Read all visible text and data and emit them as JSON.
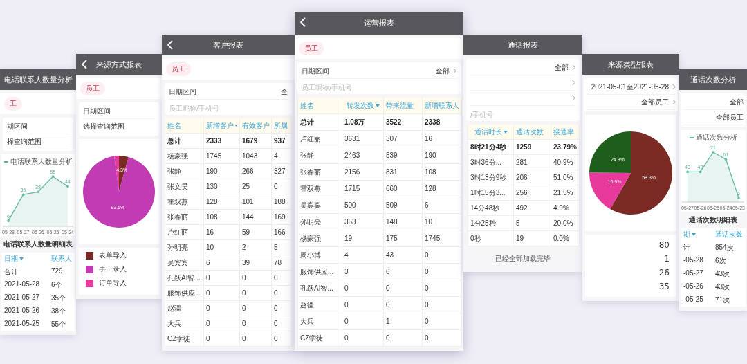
{
  "screens": [
    {
      "sections": [
        {
          "kind": "header",
          "title": "电话联系人数量分析",
          "back_button": false
        },
        {
          "kind": "tag",
          "label": "工",
          "selected": true
        },
        {
          "kind": "filters",
          "rows": [
            {
              "label": "期区间",
              "chevron": false
            },
            {
              "label": "择查询范围",
              "chevron": false
            }
          ]
        },
        {
          "kind": "chart",
          "chart_data": {
            "type": "line",
            "categories": [
              "05-28",
              "05-27",
              "05-26",
              "05-25",
              "05-24"
            ],
            "series": [
              {
                "name": "电话联系人数量分析",
                "color": "#5fb8a0",
                "values": [
                  6,
                  35,
                  38,
                  55,
                  44
                ]
              }
            ],
            "data_labels": true
          }
        },
        {
          "kind": "table_title",
          "text": "电话联系人数量明细表"
        },
        {
          "kind": "detail_table",
          "columns": [
            {
              "label": "日期",
              "sorted": true
            },
            {
              "label": "联系人",
              "sorted": false
            }
          ],
          "rows": [
            {
              "cells": [
                "合计",
                "729"
              ],
              "total": false
            },
            {
              "cells": [
                "2021-05-28",
                "6个"
              ],
              "total": false
            },
            {
              "cells": [
                "2021-05-27",
                "35个"
              ],
              "total": false
            },
            {
              "cells": [
                "2021-05-26",
                "38个"
              ],
              "total": false
            },
            {
              "cells": [
                "2021-05-25",
                "55个"
              ],
              "total": false
            }
          ]
        }
      ]
    },
    {
      "sections": [
        {
          "kind": "header",
          "title": "来源方式报表",
          "back_button": true
        },
        {
          "kind": "tag",
          "label": "员工",
          "selected": true
        },
        {
          "kind": "filters",
          "rows": [
            {
              "label": "日期区间",
              "chevron": false
            },
            {
              "label": "选择查询范围",
              "chevron": false
            }
          ]
        },
        {
          "kind": "chart",
          "chart_data": {
            "type": "pie",
            "values": [
              4.3,
              93.6,
              2.1
            ],
            "value_labels": [
              "4.3%",
              "93.6%",
              null
            ]
          },
          "slices": [
            {
              "color": "#7b2b24"
            },
            {
              "color": "#c13bb3"
            },
            {
              "color": "#e83a9c"
            }
          ]
        },
        {
          "kind": "legend",
          "items": [
            {
              "label": "表单导入",
              "color": "#7b2b24"
            },
            {
              "label": "手工录入",
              "color": "#c13bb3"
            },
            {
              "label": "订单导入",
              "color": "#e83a9c"
            }
          ]
        }
      ]
    },
    {
      "sections": [
        {
          "kind": "header",
          "title": "客户报表",
          "back_button": true
        },
        {
          "kind": "tag",
          "label": "员工",
          "selected": true
        },
        {
          "kind": "filters",
          "rows": [
            {
              "label": "日期区间",
              "value": "全",
              "chevron": false
            }
          ],
          "placeholder": "员工昵称/手机号"
        },
        {
          "kind": "table",
          "columns": [
            {
              "label": "姓名",
              "sorted": false
            },
            {
              "label": "新增客户",
              "sorted": true
            },
            {
              "label": "有效客户",
              "sorted": false
            },
            {
              "label": "所属",
              "sorted": false
            }
          ],
          "rows": [
            {
              "cells": [
                "总计",
                "2333",
                "1679",
                "937"
              ],
              "total": true
            },
            {
              "cells": [
                "杨豪强",
                "1745",
                "1043",
                "4"
              ],
              "total": false
            },
            {
              "cells": [
                "张静",
                "190",
                "266",
                "327"
              ],
              "total": false
            },
            {
              "cells": [
                "张文昊",
                "130",
                "25",
                "0"
              ],
              "total": false
            },
            {
              "cells": [
                "霍双燕",
                "128",
                "101",
                "188"
              ],
              "total": false
            },
            {
              "cells": [
                "张春丽",
                "108",
                "144",
                "169"
              ],
              "total": false
            },
            {
              "cells": [
                "卢红丽",
                "16",
                "59",
                "166"
              ],
              "total": false
            },
            {
              "cells": [
                "孙明亮",
                "10",
                "2",
                "5"
              ],
              "total": false
            },
            {
              "cells": [
                "吴宾宾",
                "6",
                "39",
                "78"
              ],
              "total": false
            },
            {
              "cells": [
                "孔跃AI智...",
                "0",
                "0",
                "0"
              ],
              "total": false
            },
            {
              "cells": [
                "服饰供应...",
                "0",
                "0",
                "0"
              ],
              "total": false
            },
            {
              "cells": [
                "赵疆",
                "0",
                "0",
                "0"
              ],
              "total": false
            },
            {
              "cells": [
                "大兵",
                "0",
                "0",
                "0"
              ],
              "total": false
            },
            {
              "cells": [
                "CZ学徒",
                "0",
                "0",
                "0"
              ],
              "total": false
            }
          ]
        }
      ]
    },
    {
      "sections": [
        {
          "kind": "header",
          "title": "运营报表",
          "back_button": true
        },
        {
          "kind": "tag",
          "label": "员工",
          "selected": true
        },
        {
          "kind": "filters",
          "rows": [
            {
              "label": "日期区间",
              "value": "全部",
              "chevron": true
            }
          ],
          "placeholder": "员工昵称/手机号"
        },
        {
          "kind": "table",
          "columns": [
            {
              "label": "姓名",
              "sorted": false
            },
            {
              "label": "转发次数",
              "sorted": true
            },
            {
              "label": "带来流量",
              "sorted": false
            },
            {
              "label": "新增联系人",
              "sorted": false
            }
          ],
          "rows": [
            {
              "cells": [
                "总计",
                "1.08万",
                "3522",
                "2338"
              ],
              "total": true
            },
            {
              "cells": [
                "卢红丽",
                "3631",
                "307",
                "16"
              ],
              "total": false
            },
            {
              "cells": [
                "张静",
                "2463",
                "839",
                "190"
              ],
              "total": false
            },
            {
              "cells": [
                "张春丽",
                "2156",
                "831",
                "108"
              ],
              "total": false
            },
            {
              "cells": [
                "霍双燕",
                "1715",
                "660",
                "128"
              ],
              "total": false
            },
            {
              "cells": [
                "吴宾宾",
                "500",
                "509",
                "6"
              ],
              "total": false
            },
            {
              "cells": [
                "孙明亮",
                "353",
                "148",
                "10"
              ],
              "total": false
            },
            {
              "cells": [
                "杨豪强",
                "19",
                "175",
                "1745"
              ],
              "total": false
            },
            {
              "cells": [
                "周小博",
                "4",
                "43",
                "0"
              ],
              "total": false
            },
            {
              "cells": [
                "服饰供应...",
                "3",
                "6",
                "0"
              ],
              "total": false
            },
            {
              "cells": [
                "孔跃AI智...",
                "0",
                "0",
                "0"
              ],
              "total": false
            },
            {
              "cells": [
                "赵疆",
                "0",
                "0",
                "0"
              ],
              "total": false
            },
            {
              "cells": [
                "大兵",
                "0",
                "1",
                "0"
              ],
              "total": false
            },
            {
              "cells": [
                "CZ学徒",
                "0",
                "0",
                "0"
              ],
              "total": false
            }
          ]
        }
      ]
    },
    {
      "sections": [
        {
          "kind": "header",
          "title": "通话报表",
          "back_button": false
        },
        {
          "kind": "filters",
          "rows": [
            {
              "value": "全部",
              "chevron": true
            },
            {
              "chevron": true
            },
            {
              "chevron": true
            }
          ],
          "placeholder": "/手机号"
        },
        {
          "kind": "table",
          "columns": [
            {
              "label": "通话时长",
              "sorted": true
            },
            {
              "label": "通话次数",
              "sorted": false
            },
            {
              "label": "接通率",
              "sorted": false
            }
          ],
          "rows": [
            {
              "cells": [
                "8时21分4秒",
                "1259",
                "23.79%"
              ],
              "total": true
            },
            {
              "cells": [
                "3时36分...",
                "281",
                "40.9%"
              ],
              "total": false
            },
            {
              "cells": [
                "3时13分9秒",
                "206",
                "51.0%"
              ],
              "total": false
            },
            {
              "cells": [
                "1时15分3...",
                "256",
                "21.5%"
              ],
              "total": false
            },
            {
              "cells": [
                "14分48秒",
                "492",
                "4.9%"
              ],
              "total": false
            },
            {
              "cells": [
                "1分25秒",
                "5",
                "20.0%"
              ],
              "total": false
            },
            {
              "cells": [
                "0秒",
                "19",
                "0.0%"
              ],
              "total": false
            }
          ]
        },
        {
          "kind": "footer",
          "text": "已经全部加载完毕"
        }
      ]
    },
    {
      "sections": [
        {
          "kind": "header",
          "title": "来源类型报表",
          "back_button": false
        },
        {
          "kind": "filters",
          "rows": [
            {
              "value": "2021-05-01至2021-05-28",
              "chevron": true
            },
            {
              "value": "全部员工",
              "chevron": true
            }
          ]
        },
        {
          "kind": "chart",
          "chart_data": {
            "type": "pie",
            "values": [
              58.3,
              16.9,
              24.8
            ],
            "value_labels": [
              "58.3%",
              "16.9%",
              "24.8%"
            ]
          },
          "slices": [
            {
              "color": "#7b2b24"
            },
            {
              "color": "#e83a9c"
            },
            {
              "color": "#1f5e1a"
            }
          ]
        },
        {
          "kind": "value_list",
          "items": [
            "80",
            "1",
            "26",
            "35"
          ]
        }
      ]
    },
    {
      "sections": [
        {
          "kind": "header",
          "title": "通话次数分析",
          "back_button": false
        },
        {
          "kind": "filters",
          "rows": [
            {
              "value": "全部",
              "chevron": false
            },
            {
              "value": "全部员工",
              "chevron": false
            }
          ]
        },
        {
          "kind": "chart",
          "chart_data": {
            "type": "line",
            "categories": [
              "05-27",
              "05-26",
              "05-25",
              "05-24",
              "05-23"
            ],
            "series": [
              {
                "name": "通话次数分析",
                "color": "#5fb8a0",
                "values": [
                  43,
                  43,
                  71,
                  61,
                  6
                ]
              }
            ],
            "data_labels": true
          }
        },
        {
          "kind": "table_title",
          "text": "通话次数明细表"
        },
        {
          "kind": "detail_table",
          "columns": [
            {
              "label": "期",
              "sorted": true
            },
            {
              "label": "通话次数",
              "sorted": false
            }
          ],
          "rows": [
            {
              "cells": [
                "计",
                "854次"
              ],
              "total": false
            },
            {
              "cells": [
                "-05-28",
                "6次"
              ],
              "total": false
            },
            {
              "cells": [
                "-05-27",
                "43次"
              ],
              "total": false
            },
            {
              "cells": [
                "-05-26",
                "43次"
              ],
              "total": false
            },
            {
              "cells": [
                "-05-25",
                "71次"
              ],
              "total": false
            }
          ]
        }
      ]
    }
  ]
}
